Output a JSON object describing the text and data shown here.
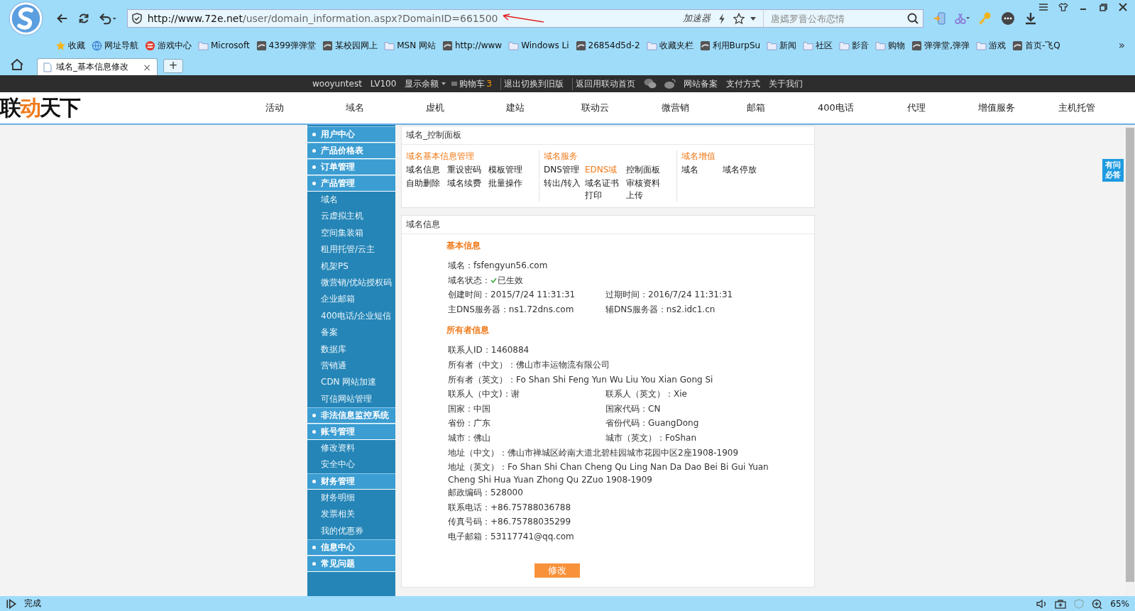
{
  "browser": {
    "url_host": "http://www.72e.net",
    "url_path": "/user/domain_information.aspx?DomainID=661500",
    "accelerator": "加速器",
    "search": {
      "placeholder": "唐嫣罗晋公布恋情"
    },
    "bookmarks": [
      {
        "label": "收藏",
        "kind": "star"
      },
      {
        "label": "网址导航",
        "kind": "globe"
      },
      {
        "label": "游戏中心",
        "kind": "game"
      },
      {
        "label": "Microsoft",
        "kind": "folder"
      },
      {
        "label": "4399弹弹堂",
        "kind": "site"
      },
      {
        "label": "某校园网上",
        "kind": "site"
      },
      {
        "label": "MSN 网站",
        "kind": "folder"
      },
      {
        "label": "http://www",
        "kind": "site"
      },
      {
        "label": "Windows Li",
        "kind": "folder"
      },
      {
        "label": "26854d5d-2",
        "kind": "site"
      },
      {
        "label": "收藏夹栏",
        "kind": "folder"
      },
      {
        "label": "利用BurpSu",
        "kind": "site"
      },
      {
        "label": "新闻",
        "kind": "folder"
      },
      {
        "label": "社区",
        "kind": "folder"
      },
      {
        "label": "影音",
        "kind": "folder"
      },
      {
        "label": "购物",
        "kind": "folder"
      },
      {
        "label": "弹弹堂,弹弹",
        "kind": "site"
      },
      {
        "label": "游戏",
        "kind": "folder"
      },
      {
        "label": "首页-飞Q",
        "kind": "site"
      }
    ],
    "more": "»",
    "tabs": [
      {
        "label": "域名_基本信息修改",
        "selected": true,
        "close": "×"
      }
    ],
    "new_tab": "+"
  },
  "topbar": {
    "user": "wooyuntest",
    "level": "LV100",
    "balance": "显示余额",
    "cart": "购物车",
    "cart_count": "3",
    "links_left": [
      "退出切换到旧版",
      "返回用联动首页"
    ],
    "links_right": [
      "网站备案",
      "支付方式",
      "关于我们"
    ]
  },
  "logo": [
    {
      "text": "联",
      "accent": false
    },
    {
      "text": "动",
      "accent": true
    },
    {
      "text": "天下",
      "accent": false
    }
  ],
  "nav": [
    "活动",
    "域名",
    "虚机",
    "建站",
    "联动云",
    "微营销",
    "邮箱",
    "400电话",
    "代理",
    "增值服务",
    "主机托管"
  ],
  "sidebar": [
    {
      "label": "用户中心",
      "kind": "header"
    },
    {
      "label": "产品价格表",
      "kind": "header"
    },
    {
      "label": "订单管理",
      "kind": "header"
    },
    {
      "label": "产品管理",
      "kind": "header"
    },
    {
      "label": "域名",
      "kind": "sub"
    },
    {
      "label": "云虚拟主机",
      "kind": "sub"
    },
    {
      "label": "空间集装箱",
      "kind": "sub"
    },
    {
      "label": "租用托管/云主",
      "kind": "sub"
    },
    {
      "label": "机架PS",
      "kind": "sub"
    },
    {
      "label": "微营销/优站授权码",
      "kind": "sub"
    },
    {
      "label": "企业邮箱",
      "kind": "sub"
    },
    {
      "label": "400电话/企业短信",
      "kind": "sub"
    },
    {
      "label": "备案",
      "kind": "sub"
    },
    {
      "label": "数据库",
      "kind": "sub"
    },
    {
      "label": "营销通",
      "kind": "sub"
    },
    {
      "label": "CDN 网站加速",
      "kind": "sub"
    },
    {
      "label": "可信网站管理",
      "kind": "sub"
    },
    {
      "label": "非法信息监控系统",
      "kind": "header"
    },
    {
      "label": "账号管理",
      "kind": "header"
    },
    {
      "label": "修改资料",
      "kind": "sub"
    },
    {
      "label": "安全中心",
      "kind": "sub"
    },
    {
      "label": "财务管理",
      "kind": "header"
    },
    {
      "label": "财务明细",
      "kind": "sub"
    },
    {
      "label": "发票相关",
      "kind": "sub"
    },
    {
      "label": "我的优惠券",
      "kind": "sub"
    },
    {
      "label": "信息中心",
      "kind": "header"
    },
    {
      "label": "常见问题",
      "kind": "header"
    }
  ],
  "control_panel": {
    "title": "域名_控制面板",
    "groups": [
      {
        "title": "域名基本信息管理",
        "links": [
          {
            "label": "域名信息",
            "highlight": false
          },
          {
            "label": "重设密码",
            "highlight": false
          },
          {
            "label": "模板管理",
            "highlight": false
          },
          {
            "label": "自助删除",
            "highlight": false
          },
          {
            "label": "域名续费",
            "highlight": false
          },
          {
            "label": "批量操作",
            "highlight": false
          }
        ]
      },
      {
        "title": "域名服务",
        "links": [
          {
            "label": "DNS管理",
            "highlight": false
          },
          {
            "label": "EDNS域",
            "highlight": true
          },
          {
            "label": "控制面板",
            "highlight": false
          },
          {
            "label": "转出/转入",
            "highlight": false
          },
          {
            "label": "域名证书打印",
            "highlight": false
          },
          {
            "label": "审核资料上传",
            "highlight": false
          }
        ]
      },
      {
        "title": "域名增值",
        "links": [
          {
            "label": "域名",
            "highlight": false
          },
          {
            "label": "域名停放",
            "highlight": false
          }
        ]
      }
    ]
  },
  "domain_info": {
    "title": "域名信息",
    "sections": [
      {
        "title": "基本信息",
        "rows": [
          [
            {
              "text": "域名：fsfengyun56.com"
            }
          ],
          [
            {
              "text": "域名状态：",
              "status": "已生效"
            }
          ],
          [
            {
              "text": "创建时间：2015/7/24 11:31:31"
            },
            {
              "text": "过期时间：2016/7/24 11:31:31"
            }
          ],
          [
            {
              "text": "主DNS服务器：ns1.72dns.com"
            },
            {
              "text": "辅DNS服务器：ns2.idc1.cn"
            }
          ]
        ]
      },
      {
        "title": "所有者信息",
        "rows": [
          [
            {
              "text": "联系人ID：1460884"
            }
          ],
          [
            {
              "text": "所有者（中文）：佛山市丰运物流有限公司"
            }
          ],
          [
            {
              "text": "所有者（英文）：Fo Shan Shi Feng Yun Wu Liu You Xian Gong Si"
            }
          ],
          [
            {
              "text": "联系人（中文)：谢"
            },
            {
              "text": "联系人（英文）：Xie"
            }
          ],
          [
            {
              "text": "国家：中国"
            },
            {
              "text": "国家代码：CN"
            }
          ],
          [
            {
              "text": "省份：广东"
            },
            {
              "text": "省份代码：GuangDong"
            }
          ],
          [
            {
              "text": "城市：佛山"
            },
            {
              "text": "城市（英文）：FoShan"
            }
          ],
          [
            {
              "text": "地址（中文）：佛山市禅城区岭南大道北碧桂园城市花园中区2座1908-1909"
            }
          ],
          [
            {
              "text": "地址（英文）：Fo Shan Shi Chan Cheng Qu Ling Nan Da Dao Bei Bi Gui Yuan Cheng Shi Hua Yuan Zhong Qu 2Zuo 1908-1909"
            }
          ],
          [
            {
              "text": "邮政编码：528000"
            }
          ],
          [
            {
              "text": "联系电话：+86.75788036788"
            }
          ],
          [
            {
              "text": "传真号码：+86.75788035299"
            }
          ],
          [
            {
              "text": "电子邮箱：53117741@qq.com"
            }
          ]
        ]
      }
    ],
    "button": "修改"
  },
  "float_button": "有问必答",
  "status_bar": {
    "text": "完成",
    "zoom": "65%"
  }
}
